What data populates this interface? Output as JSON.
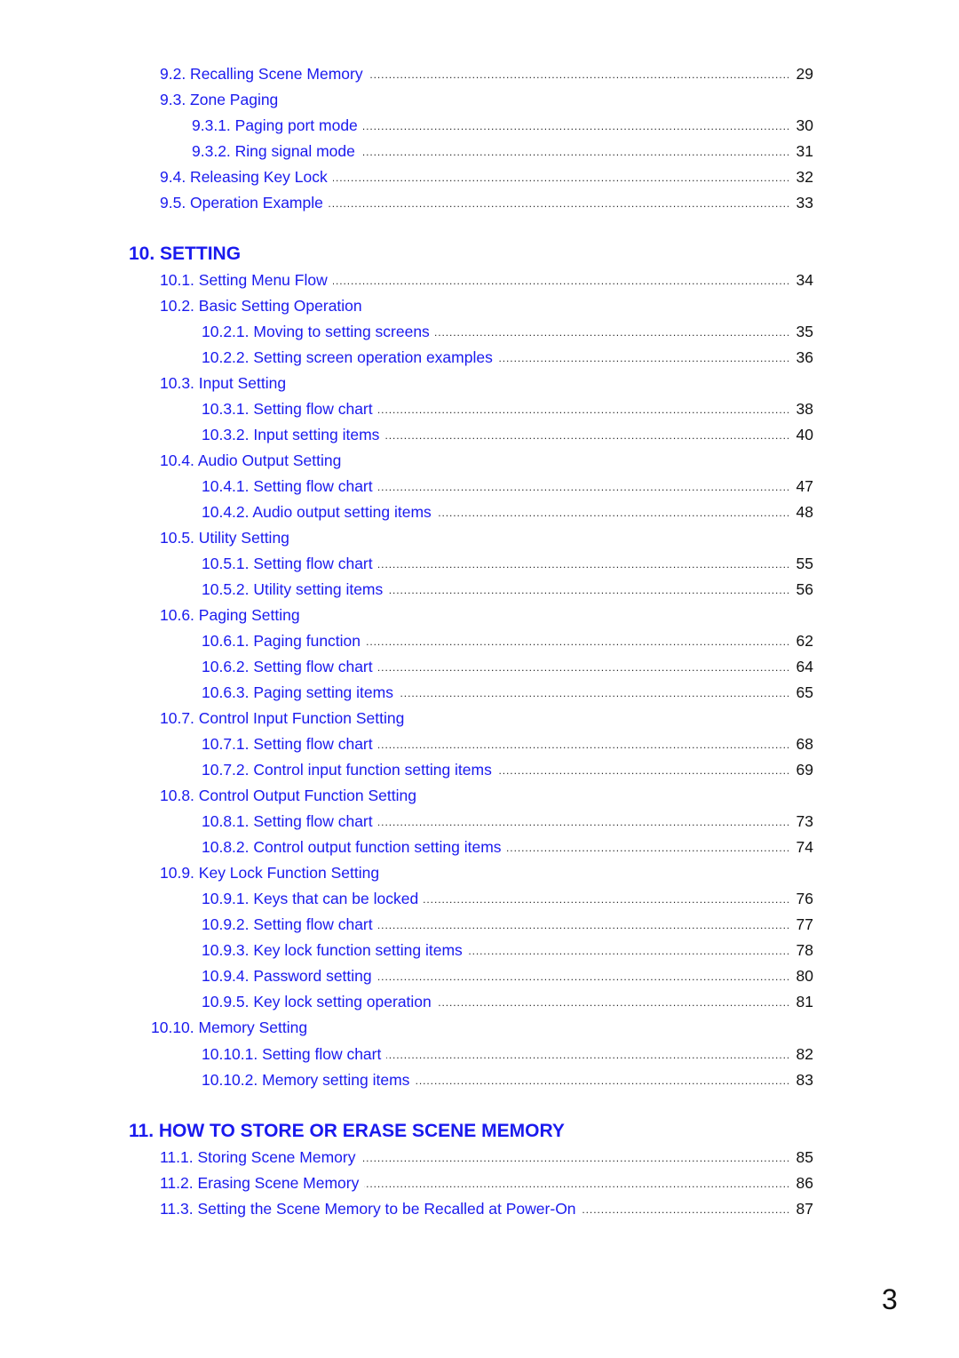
{
  "colors": {
    "link": "#1a1aee",
    "text": "#111111"
  },
  "entries_top": [
    {
      "title": "9.2. Recalling Scene Memory",
      "page": "29",
      "level": 1
    },
    {
      "title": "9.3. Zone Paging",
      "page": "",
      "level": 1
    },
    {
      "title": "9.3.1. Paging port mode",
      "page": "30",
      "level": 2
    },
    {
      "title": "9.3.2. Ring signal mode",
      "page": "31",
      "level": 2
    },
    {
      "title": "9.4. Releasing Key Lock",
      "page": "32",
      "level": 1
    },
    {
      "title": "9.5. Operation Example",
      "page": "33",
      "level": 1
    }
  ],
  "section10": {
    "heading": "10. SETTING",
    "entries": [
      {
        "title": "10.1. Setting Menu Flow",
        "page": "34"
      },
      {
        "title": "10.2. Basic Setting Operation",
        "page": ""
      },
      {
        "title": "10.2.1. Moving to setting screens",
        "page": "35"
      },
      {
        "title": "10.2.2. Setting screen operation examples",
        "page": "36"
      },
      {
        "title": "10.3. Input Setting",
        "page": ""
      },
      {
        "title": "10.3.1. Setting flow chart",
        "page": "38"
      },
      {
        "title": "10.3.2. Input setting items",
        "page": "40"
      },
      {
        "title": "10.4. Audio Output Setting",
        "page": ""
      },
      {
        "title": "10.4.1. Setting flow chart",
        "page": "47"
      },
      {
        "title": "10.4.2. Audio output setting items",
        "page": "48"
      },
      {
        "title": "10.5. Utility Setting",
        "page": ""
      },
      {
        "title": "10.5.1. Setting flow chart",
        "page": "55"
      },
      {
        "title": "10.5.2. Utility setting items",
        "page": "56"
      },
      {
        "title": "10.6. Paging Setting",
        "page": ""
      },
      {
        "title": "10.6.1. Paging function",
        "page": "62"
      },
      {
        "title": "10.6.2. Setting flow chart",
        "page": "64"
      },
      {
        "title": "10.6.3. Paging setting items",
        "page": "65"
      },
      {
        "title": "10.7. Control Input Function Setting",
        "page": ""
      },
      {
        "title": "10.7.1. Setting flow chart",
        "page": "68"
      },
      {
        "title": "10.7.2. Control input function setting items",
        "page": "69"
      },
      {
        "title": "10.8. Control Output Function Setting",
        "page": ""
      },
      {
        "title": "10.8.1. Setting flow chart",
        "page": "73"
      },
      {
        "title": "10.8.2. Control output function setting items",
        "page": "74"
      },
      {
        "title": "10.9. Key Lock Function Setting",
        "page": ""
      },
      {
        "title": "10.9.1. Keys that can be locked",
        "page": "76"
      },
      {
        "title": "10.9.2. Setting flow chart",
        "page": "77"
      },
      {
        "title": "10.9.3. Key lock function setting items",
        "page": "78"
      },
      {
        "title": "10.9.4. Password setting",
        "page": "80"
      },
      {
        "title": "10.9.5. Key lock setting operation",
        "page": "81"
      },
      {
        "title": "10.10. Memory Setting",
        "page": ""
      },
      {
        "title": "10.10.1. Setting flow chart",
        "page": "82"
      },
      {
        "title": "10.10.2. Memory setting items",
        "page": "83"
      }
    ]
  },
  "section11": {
    "heading": "11. HOW TO STORE OR ERASE SCENE MEMORY",
    "entries": [
      {
        "title": "11.1. Storing Scene Memory",
        "page": "85"
      },
      {
        "title": "11.2. Erasing Scene Memory",
        "page": "86"
      },
      {
        "title": "11.3. Setting the Scene Memory to be Recalled at Power-On",
        "page": "87"
      }
    ]
  },
  "page_number": "3"
}
